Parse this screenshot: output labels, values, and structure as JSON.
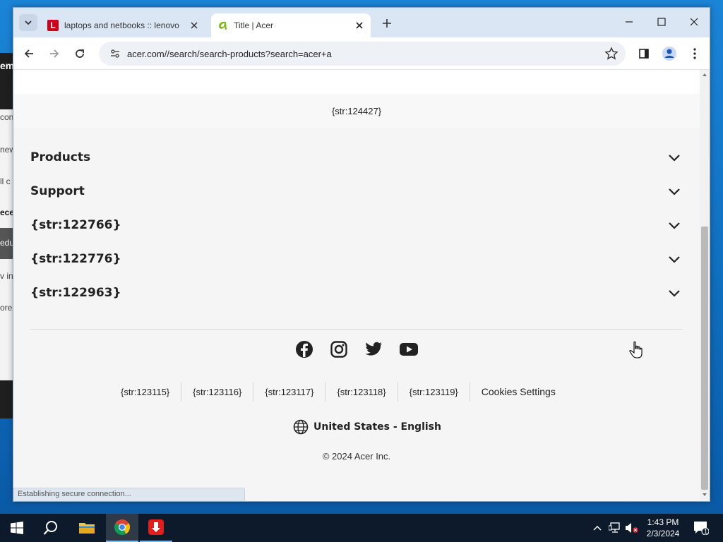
{
  "browser": {
    "tabs": [
      {
        "label": "laptops and netbooks :: lenovo",
        "favicon_letter": "L",
        "active": false
      },
      {
        "label": "Title | Acer",
        "favicon_letter": "a",
        "active": true
      }
    ],
    "address_bar": {
      "url": "acer.com//search/search-products?search=acer+a"
    },
    "status_text": "Establishing secure connection..."
  },
  "page": {
    "top_string": "{str:124427}",
    "accordion": [
      {
        "label": "Products"
      },
      {
        "label": "Support"
      },
      {
        "label": "{str:122766}"
      },
      {
        "label": "{str:122776}"
      },
      {
        "label": "{str:122963}"
      }
    ],
    "social_icons": [
      "facebook-icon",
      "instagram-icon",
      "twitter-icon",
      "youtube-icon"
    ],
    "footer_links": [
      {
        "label": "{str:123115}"
      },
      {
        "label": "{str:123116}"
      },
      {
        "label": "{str:123117}"
      },
      {
        "label": "{str:123118}"
      },
      {
        "label": "{str:123119}"
      },
      {
        "label": "Cookies Settings"
      }
    ],
    "locale": "United States - English",
    "copyright": "© 2024 Acer Inc."
  },
  "background_window": {
    "snippets": [
      "em",
      "con",
      "new",
      "ll c",
      "ece",
      "edu",
      "v in",
      "ore"
    ]
  },
  "taskbar": {
    "clock_time": "1:43 PM",
    "clock_date": "2/3/2024",
    "notification_count": "1"
  },
  "colors": {
    "accent": "#83b81a",
    "lenovo_red": "#d0021b",
    "taskbar": "#0c1a2b"
  }
}
